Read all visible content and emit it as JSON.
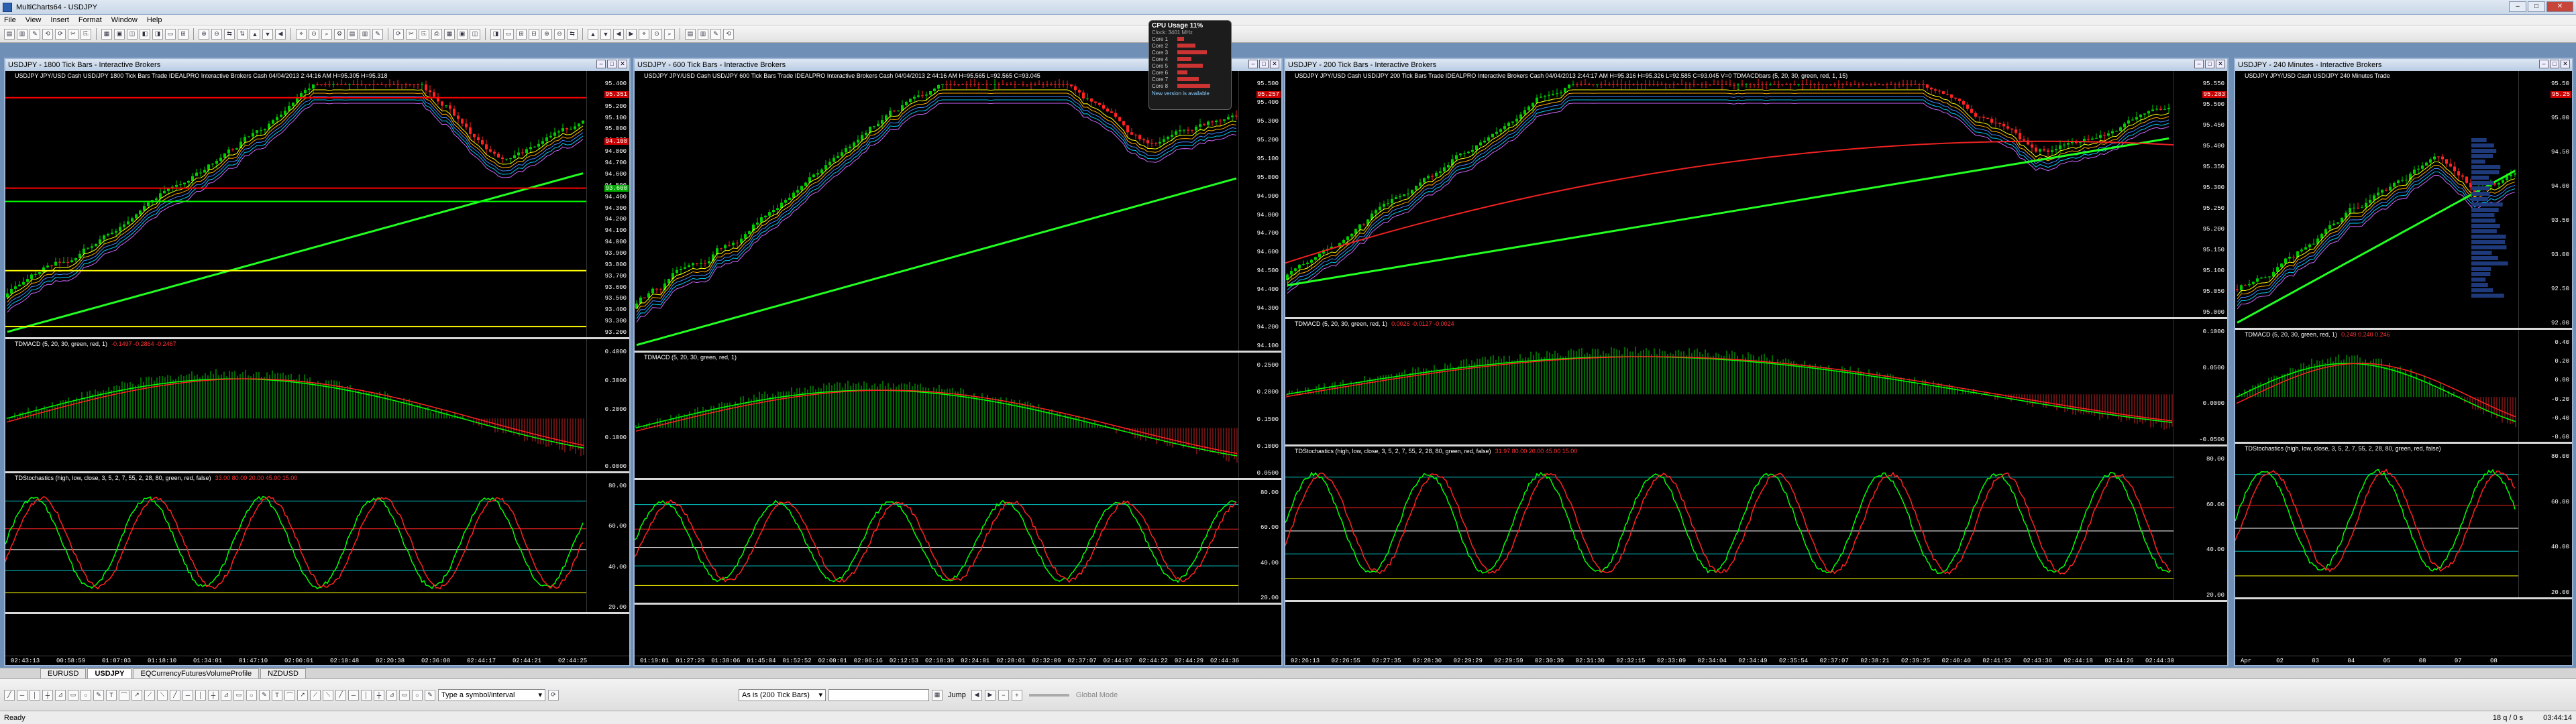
{
  "app": {
    "title": "MultiCharts64 - USDJPY",
    "clock": "03:44:14",
    "counter": "18 q / 0 s",
    "status": "Ready"
  },
  "menu": [
    "File",
    "View",
    "Insert",
    "Format",
    "Window",
    "Help"
  ],
  "windows": [
    {
      "title": "USDJPY - 1800 Tick Bars - Interactive Brokers",
      "info": "USDJPY  JPY/USD Cash USD/JPY  1800 Tick Bars  Trade  IDEALPRO  Interactive Brokers  Cash  04/04/2013  2:44:16 AM  H=95.305  H=95.318",
      "price_ticks": [
        "95.400",
        "95.300",
        "95.200",
        "95.100",
        "95.000",
        "94.900",
        "94.800",
        "94.700",
        "94.600",
        "94.500",
        "94.400",
        "94.300",
        "94.200",
        "94.100",
        "94.000",
        "93.900",
        "93.800",
        "93.700",
        "93.600",
        "93.500",
        "93.400",
        "93.300",
        "93.200"
      ],
      "tags": [
        {
          "t": "95.351",
          "c": "#c00"
        },
        {
          "t": "94.108",
          "c": "#c00"
        },
        {
          "t": "93.600",
          "c": "#0a0"
        }
      ],
      "macd_info": "TDMACD (5, 20, 30, green, red, 1)",
      "macd_vals": "-0.1497  -0.2864  -0.2467",
      "macd_ticks": [
        "0.4000",
        "0.3000",
        "0.2000",
        "0.1000",
        "0.0000"
      ],
      "stoch_info": "TDStochastics (high, low, close, 3, 5, 2, 7, 55, 2, 28, 80, green, red, false)",
      "stoch_vals": "33.00  80.00  20.00  45.00  15.00",
      "stoch_ticks": [
        "80.00",
        "60.00",
        "40.00",
        "20.00"
      ],
      "times": [
        "02:43:13",
        "00:58:59",
        "01:07:03",
        "01:18:10",
        "01:34:01",
        "01:47:10",
        "02:00:01",
        "02:10:48",
        "02:20:38",
        "02:36:08",
        "02:44:17",
        "02:44:21",
        "02:44:25"
      ]
    },
    {
      "title": "USDJPY - 600 Tick Bars - Interactive Brokers",
      "info": "USDJPY  JPY/USD Cash USD/JPY  600 Tick Bars  Trade  IDEALPRO  Interactive Brokers  Cash  04/04/2013  2:44:16 AM  H=95.565  L=92.565  C=93.045",
      "price_ticks": [
        "95.500",
        "95.400",
        "95.300",
        "95.200",
        "95.100",
        "95.000",
        "94.900",
        "94.800",
        "94.700",
        "94.600",
        "94.500",
        "94.400",
        "94.300",
        "94.200",
        "94.100"
      ],
      "tags": [
        {
          "t": "95.257",
          "c": "#c00"
        }
      ],
      "macd_info": "TDMACD (5, 20, 30, green, red, 1)",
      "macd_vals": "",
      "macd_ticks": [
        "0.2500",
        "0.2000",
        "0.1500",
        "0.1000",
        "0.0500"
      ],
      "stoch_info": "",
      "stoch_vals": "",
      "stoch_ticks": [
        "80.00",
        "60.00",
        "40.00",
        "20.00"
      ],
      "times": [
        "01:19:01",
        "01:27:29",
        "01:38:06",
        "01:45:04",
        "01:52:52",
        "02:00:01",
        "02:06:16",
        "02:12:53",
        "02:18:39",
        "02:24:01",
        "02:28:01",
        "02:32:09",
        "02:37:07",
        "02:44:07",
        "02:44:22",
        "02:44:29",
        "02:44:36"
      ]
    },
    {
      "title": "USDJPY - 200 Tick Bars - Interactive Brokers",
      "info": "USDJPY  JPY/USD Cash USD/JPY  200 Tick Bars  Trade  IDEALPRO  Interactive Brokers  Cash  04/04/2013  2:44:17 AM  H=95.316  H=95.326  L=92.585  C=93.045  V=0  TDMACDbars (5, 20, 30, green, red, 1, 15)",
      "price_ticks": [
        "95.550",
        "95.500",
        "95.450",
        "95.400",
        "95.350",
        "95.300",
        "95.250",
        "95.200",
        "95.150",
        "95.100",
        "95.050",
        "95.000"
      ],
      "tags": [
        {
          "t": "95.283",
          "c": "#c00"
        }
      ],
      "macd_info": "TDMACD (5, 20, 30, green, red, 1)",
      "macd_vals": "0.0026  -0.0127  -0.0024",
      "macd_ticks": [
        "0.1000",
        "0.0500",
        "0.0000",
        "-0.0500"
      ],
      "stoch_info": "TDStochastics (high, low, close, 3, 5, 2, 7, 55, 2, 28, 80, green, red, false)",
      "stoch_vals": "31.97  80.00  20.00  45.00  15.00",
      "stoch_ticks": [
        "80.00",
        "60.00",
        "40.00",
        "20.00"
      ],
      "times": [
        "02:26:13",
        "02:26:55",
        "02:27:35",
        "02:28:30",
        "02:29:29",
        "02:29:59",
        "02:30:39",
        "02:31:30",
        "02:32:15",
        "02:33:09",
        "02:34:04",
        "02:34:49",
        "02:35:54",
        "02:37:07",
        "02:38:21",
        "02:39:25",
        "02:40:40",
        "02:41:52",
        "02:43:36",
        "02:44:18",
        "02:44:26",
        "02:44:30"
      ]
    },
    {
      "title": "USDJPY - 240 Minutes - Interactive Brokers",
      "info": "USDJPY  JPY/USD Cash USD/JPY  240 Minutes  Trade",
      "price_ticks": [
        "95.50",
        "95.00",
        "94.50",
        "94.00",
        "93.50",
        "93.00",
        "92.50",
        "92.00"
      ],
      "tags": [
        {
          "t": "95.25",
          "c": "#c00"
        }
      ],
      "macd_info": "TDMACD (5, 20, 30, green, red, 1)",
      "macd_vals": "0.249  0.240  0.246",
      "macd_ticks": [
        "0.40",
        "0.20",
        "0.00",
        "-0.20",
        "-0.40",
        "-0.60"
      ],
      "stoch_info": "TDStochastics (high, low, close, 3, 5, 2, 7, 55, 2, 28, 80, green, red, false)",
      "stoch_vals": "",
      "stoch_ticks": [
        "80.00",
        "60.00",
        "40.00",
        "20.00"
      ],
      "times": [
        "Apr",
        "02",
        "03",
        "04",
        "05",
        "08",
        "07",
        "08"
      ]
    }
  ],
  "cpu": {
    "title": "CPU Usage  11%",
    "sub": "Clock: 3401 MHz",
    "cores": [
      "Core 1",
      "Core 2",
      "Core 3",
      "Core 4",
      "Core 5",
      "Core 6",
      "Core 7",
      "Core 8"
    ],
    "foot": "New version is available"
  },
  "tabs": [
    "EURUSD",
    "USDJPY",
    "EQCurrencyFuturesVolumeProfile",
    "NZDUSD"
  ],
  "drawbar": {
    "symbol_placeholder": "Type a symbol/interval",
    "resolution": "As is (200 Tick Bars)",
    "jump": "Jump",
    "global_mode": "Global Mode"
  }
}
